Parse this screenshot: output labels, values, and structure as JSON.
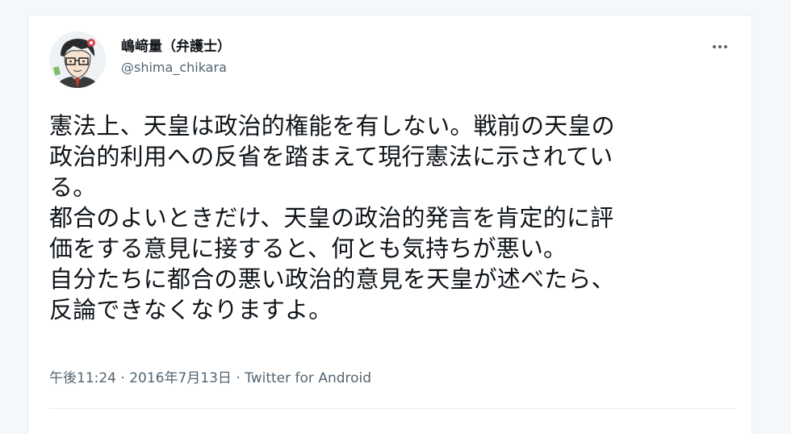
{
  "author": {
    "display_name": "嶋﨑量（弁護士）",
    "handle": "@shima_chikara"
  },
  "tweet": {
    "lines": [
      "憲法上、天皇は政治的権能を有しない。戦前の天皇の",
      "政治的利用への反省を踏まえて現行憲法に示されてい",
      "る。",
      "都合のよいときだけ、天皇の政治的発言を肯定的に評",
      "価をする意見に接すると、何とも気持ちが悪い。",
      "自分たちに都合の悪い政治的意見を天皇が述べたら、",
      "反論できなくなりますよ。"
    ]
  },
  "meta": {
    "time": "午後11:24",
    "separator": "·",
    "date": "2016年7月13日",
    "source": "Twitter for Android"
  },
  "icons": {
    "more": "more-horizontal-icon",
    "avatar": "avatar-illustration"
  },
  "colors": {
    "text_primary": "#0f1419",
    "text_secondary": "#536471",
    "border": "#e6ecf0"
  }
}
